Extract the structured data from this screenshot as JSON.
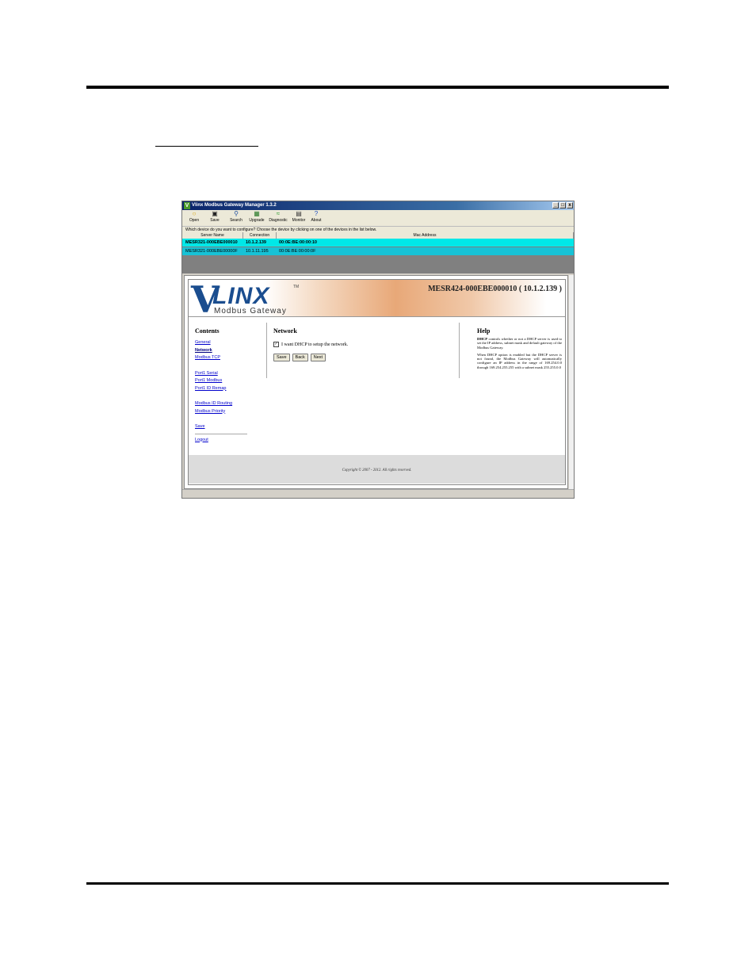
{
  "window": {
    "title": "Vlinx Modbus Gateway Manager 1.3.2",
    "buttons": [
      "_",
      "□",
      "x"
    ]
  },
  "toolbar": {
    "items": [
      {
        "label": "Open",
        "icon": "folder-open-icon"
      },
      {
        "label": "Save",
        "icon": "floppy-disk-icon"
      },
      {
        "label": "Search",
        "icon": "search-icon"
      },
      {
        "label": "Upgrade",
        "icon": "upgrade-icon"
      },
      {
        "label": "Diagnostic",
        "icon": "diagnostic-icon"
      },
      {
        "label": "Monitor",
        "icon": "monitor-icon"
      },
      {
        "label": "About",
        "icon": "help-icon"
      }
    ]
  },
  "device_list": {
    "prompt": "Which device do you want to configure? Choose the device by clicking on one of the devices in the list below.",
    "columns": [
      "Server Name",
      "Connection",
      "Mac Address"
    ],
    "rows": [
      {
        "name": "MESR321-000EBE000010",
        "connection": "10.1.2.139",
        "mac": "00:0E:BE:00:00:10",
        "selected": true
      },
      {
        "name": "MESR321-000EBE00000F",
        "connection": "10.1.11.195",
        "mac": "00:0E:BE:00:00:0F",
        "selected": false
      }
    ]
  },
  "banner": {
    "logo_v": "V",
    "logo_linx": "LINX",
    "logo_tm": "TM",
    "logo_sub": "Modbus Gateway",
    "device_title": "MESR424-000EBE000010 ( 10.1.2.139 )"
  },
  "contents": {
    "heading": "Contents",
    "links": [
      "General",
      "Network",
      "Modbus TCP",
      "Port1 Serial",
      "Port1 Modbus",
      "Port1 ID Remap",
      "Modbus ID Routing",
      "Modbus Priority",
      "Save",
      "Logout"
    ],
    "current": "Network"
  },
  "network": {
    "heading": "Network",
    "dhcp_label": "I want DHCP to setup the network.",
    "dhcp_checked": true,
    "buttons": {
      "save": "Save",
      "back": "Back",
      "next": "Next"
    }
  },
  "help": {
    "heading": "Help",
    "dhcp_word": "DHCP",
    "p1_rest": " controls whether or not a DHCP server is used to set the IP address, subnet mask and default gateway of the Modbus Gateway.",
    "p2": "When DHCP option is enabled but the DHCP server is not found, the Modbus Gateway will automatically configure an IP address in the range of 169.254.0.0 through 169.254.255.255 with a subnet mask 255.255.0.0"
  },
  "footer": {
    "copyright": "Copyright © 2007 - 2012.  All rights reserved."
  }
}
